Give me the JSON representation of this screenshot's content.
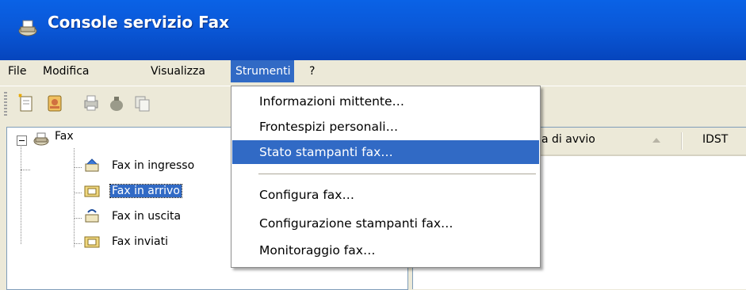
{
  "window": {
    "title": "Console servizio Fax",
    "title_icon": "fax-console-icon"
  },
  "menubar": {
    "items": [
      "File",
      "Modifica",
      "Visualizza",
      "Strumenti",
      "?"
    ],
    "active": "Strumenti"
  },
  "toolbar": {
    "buttons": [
      "new-fax-icon",
      "address-book-icon",
      "print-icon",
      "bag-icon",
      "copy-icon"
    ]
  },
  "tree": {
    "root": "Fax",
    "children": [
      "Fax in ingresso",
      "Fax in arrivo",
      "Fax in uscita",
      "Fax inviati"
    ],
    "selected": "Fax in arrivo"
  },
  "list": {
    "columns": [
      "a di avvio",
      "IDST"
    ]
  },
  "dropdown": {
    "items": [
      "Informazioni mittente…",
      "Frontespizi personali…",
      "Stato stampanti fax…",
      "Configura fax…",
      "Configurazione stampanti fax…",
      "Monitoraggio fax…"
    ],
    "highlighted": "Stato stampanti fax…"
  },
  "colors": {
    "titlebar": "#0a58d8",
    "selection": "#316ac5",
    "chrome": "#ece9d8"
  }
}
